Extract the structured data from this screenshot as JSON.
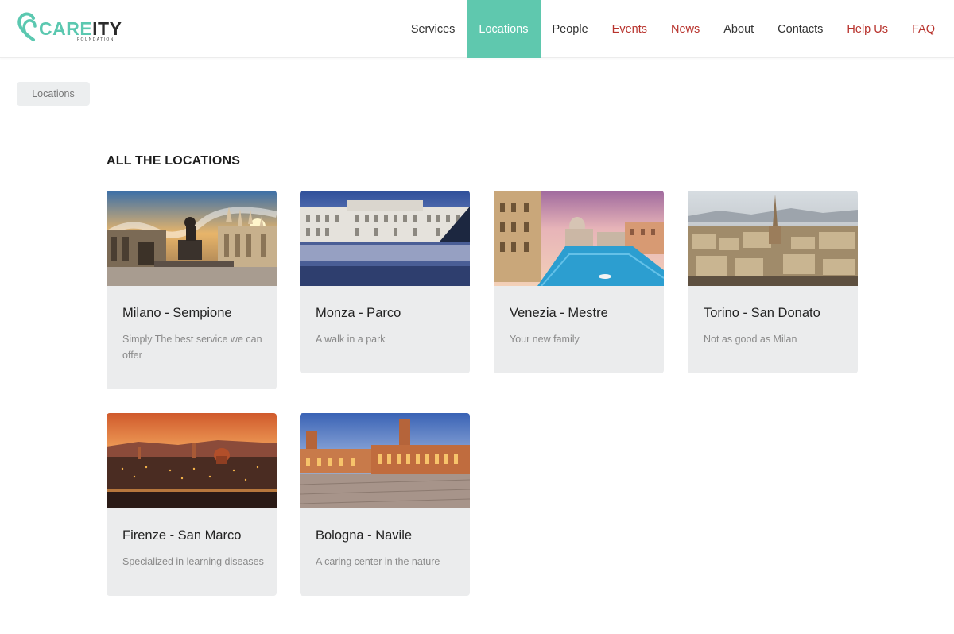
{
  "header": {
    "logo": {
      "care": "CARE",
      "ity": "ITY",
      "sub": "FOUNDATION",
      "accent": "#5bc8b0"
    },
    "nav": [
      {
        "label": "Services",
        "style": "normal"
      },
      {
        "label": "Locations",
        "style": "active"
      },
      {
        "label": "People",
        "style": "normal"
      },
      {
        "label": "Events",
        "style": "red"
      },
      {
        "label": "News",
        "style": "red"
      },
      {
        "label": "About",
        "style": "normal"
      },
      {
        "label": "Contacts",
        "style": "normal"
      },
      {
        "label": "Help Us",
        "style": "red"
      },
      {
        "label": "FAQ",
        "style": "red"
      }
    ],
    "active_color": "#5fc8ae",
    "link_red": "#b8332d"
  },
  "breadcrumb": {
    "label": "Locations"
  },
  "main": {
    "title": "ALL THE LOCATIONS",
    "cards": [
      {
        "title": "Milano - Sempione",
        "desc": "Simply The best service we can offer",
        "image": "milan-cathedral-square"
      },
      {
        "title": "Monza - Parco",
        "desc": "A walk in a park",
        "image": "monza-royal-villa"
      },
      {
        "title": "Venezia - Mestre",
        "desc": "Your new family",
        "image": "venice-grand-canal"
      },
      {
        "title": "Torino - San Donato",
        "desc": "Not as good as Milan",
        "image": "turin-skyline"
      },
      {
        "title": "Firenze - San Marco",
        "desc": "Specialized in learning diseases",
        "image": "florence-sunset"
      },
      {
        "title": "Bologna - Navile",
        "desc": "A caring center in the nature",
        "image": "bologna-piazza"
      }
    ]
  }
}
